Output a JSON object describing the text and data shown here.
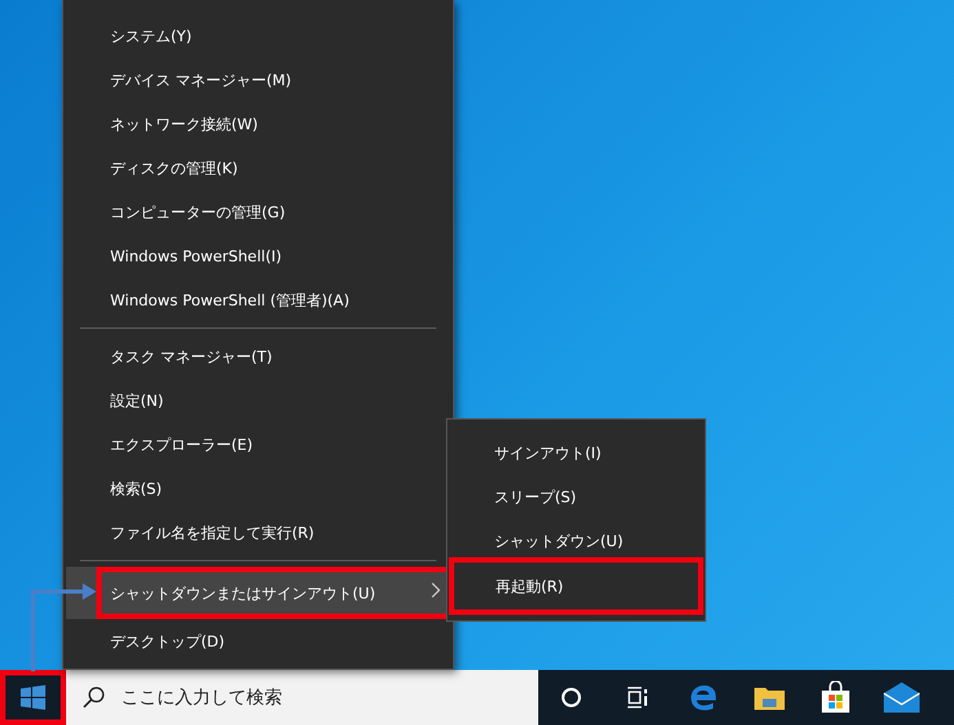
{
  "context_menu": {
    "groups": [
      [
        {
          "label": "システム(Y)",
          "selected": false,
          "highlighted": false,
          "kind": "plain"
        },
        {
          "label": "デバイス マネージャー(M)",
          "selected": false,
          "highlighted": false,
          "kind": "plain"
        },
        {
          "label": "ネットワーク接続(W)",
          "selected": false,
          "highlighted": false,
          "kind": "plain"
        },
        {
          "label": "ディスクの管理(K)",
          "selected": false,
          "highlighted": false,
          "kind": "plain"
        },
        {
          "label": "コンピューターの管理(G)",
          "selected": false,
          "highlighted": false,
          "kind": "plain"
        },
        {
          "label": "Windows PowerShell(I)",
          "selected": false,
          "highlighted": false,
          "kind": "plain"
        },
        {
          "label": "Windows PowerShell (管理者)(A)",
          "selected": false,
          "highlighted": false,
          "kind": "plain"
        }
      ],
      [
        {
          "label": "タスク マネージャー(T)",
          "selected": false,
          "highlighted": false,
          "kind": "plain"
        },
        {
          "label": "設定(N)",
          "selected": false,
          "highlighted": false,
          "kind": "plain"
        },
        {
          "label": "エクスプローラー(E)",
          "selected": false,
          "highlighted": false,
          "kind": "plain"
        },
        {
          "label": "検索(S)",
          "selected": false,
          "highlighted": false,
          "kind": "plain"
        },
        {
          "label": "ファイル名を指定して実行(R)",
          "selected": false,
          "highlighted": false,
          "kind": "plain"
        }
      ],
      [
        {
          "label": "シャットダウンまたはサインアウト(U)",
          "selected": true,
          "highlighted": true,
          "kind": "submenu"
        },
        {
          "label": "デスクトップ(D)",
          "selected": false,
          "highlighted": false,
          "kind": "plain"
        }
      ]
    ]
  },
  "submenu": {
    "items": [
      {
        "label": "サインアウト(I)",
        "highlighted": false
      },
      {
        "label": "スリープ(S)",
        "highlighted": false
      },
      {
        "label": "シャットダウン(U)",
        "highlighted": false
      },
      {
        "label": "再起動(R)",
        "highlighted": true
      }
    ]
  },
  "taskbar": {
    "start_button": {
      "highlighted": true
    },
    "search": {
      "placeholder": "ここに入力して検索"
    }
  }
}
